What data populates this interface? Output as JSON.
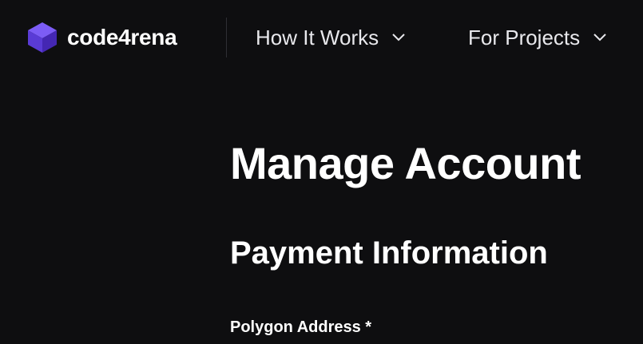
{
  "header": {
    "brand": {
      "name": "code4rena",
      "icon": "cube-logo-icon",
      "icon_colors": {
        "top": "#7c5cf5",
        "left": "#5a3bd6",
        "right": "#4a2fb8"
      }
    },
    "nav": [
      {
        "label": "How It Works",
        "icon": "chevron-down-icon"
      },
      {
        "label": "For Projects",
        "icon": "chevron-down-icon"
      }
    ]
  },
  "main": {
    "page_title": "Manage Account",
    "section_title": "Payment Information",
    "field_label": "Polygon Address *"
  },
  "colors": {
    "background": "#0e0e10",
    "text": "#ffffff",
    "accent": "#6b4ef0"
  }
}
